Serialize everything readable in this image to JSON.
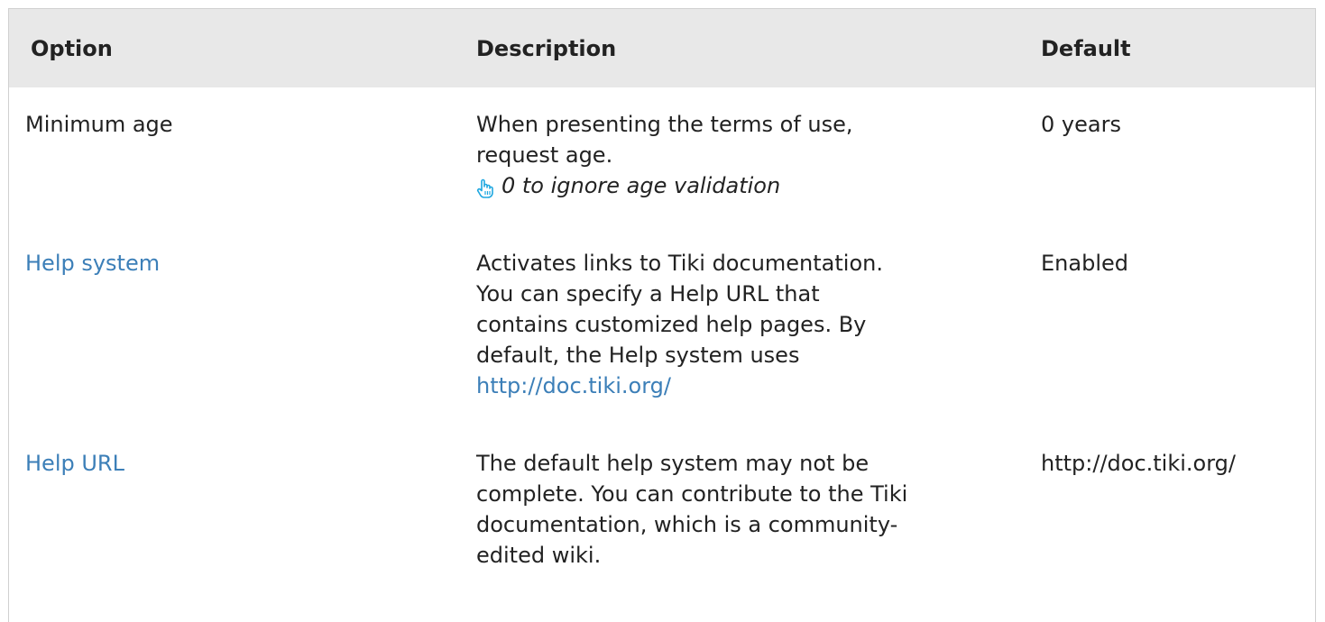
{
  "table": {
    "headers": {
      "option": "Option",
      "description": "Description",
      "default": "Default"
    },
    "rows": [
      {
        "option": "Minimum age",
        "description_lines": [
          "When presenting the terms of use,",
          "request age."
        ],
        "tip": "0 to ignore age validation",
        "default": "0 years"
      },
      {
        "option": "Help system",
        "description_lines": [
          "Activates links to Tiki documentation.",
          "You can specify a Help URL that",
          "contains customized help pages. By",
          "default, the Help system uses"
        ],
        "description_link": "http://doc.tiki.org/",
        "default": "Enabled"
      },
      {
        "option": "Help URL",
        "description_lines": [
          "The default help system may not be",
          "complete. You can contribute to the Tiki",
          "documentation, which is a community-",
          "edited wiki."
        ],
        "default": "http://doc.tiki.org/"
      }
    ]
  },
  "colors": {
    "header_bg": "#e8e8e8",
    "link": "#3c7fb8",
    "tip_icon": "#1ea7e0"
  },
  "icons": {
    "tip": "pointing-hand-icon"
  }
}
